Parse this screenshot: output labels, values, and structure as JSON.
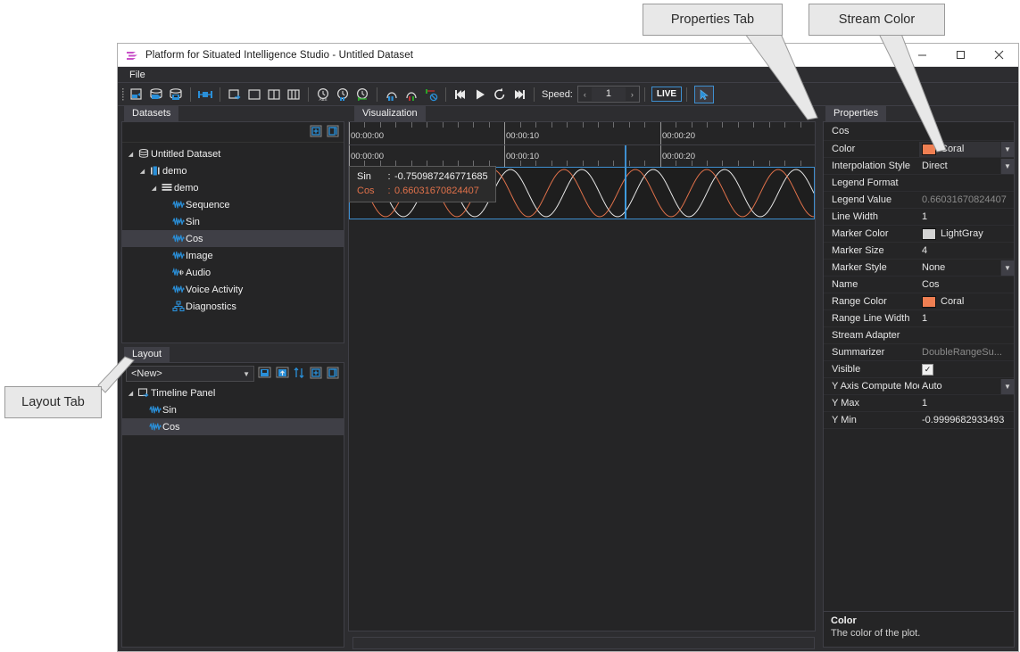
{
  "annotations": [
    {
      "id": "properties-tab",
      "label": "Properties Tab"
    },
    {
      "id": "stream-color",
      "label": "Stream Color"
    },
    {
      "id": "layout-tab",
      "label": "Layout Tab"
    }
  ],
  "window": {
    "title": "Platform for Situated Intelligence Studio - Untitled Dataset",
    "minimize_label": "—",
    "maximize_label": "☐",
    "close_label": "✕"
  },
  "menu": {
    "items": [
      {
        "label": "File"
      }
    ]
  },
  "toolbar": {
    "buttons": [
      {
        "name": "open-dataset-icon",
        "title": "Open Dataset"
      },
      {
        "name": "open-store-icon",
        "title": "Open Store"
      },
      {
        "name": "save-store-icon",
        "title": "Save Store"
      },
      {
        "name": "selection-icon",
        "title": "Selection"
      },
      {
        "name": "insert-timeline-panel-icon",
        "title": "Insert Timeline Panel"
      },
      {
        "name": "insert-1cell-panel-icon",
        "title": "Insert 1 Cell Panel"
      },
      {
        "name": "insert-2cell-panel-icon",
        "title": "Insert 2 Cell Panel"
      },
      {
        "name": "insert-3cell-panel-icon",
        "title": "Insert 3 Cell Panel"
      },
      {
        "name": "absolute-timing-icon",
        "title": "Absolute Timing"
      },
      {
        "name": "timing-relative-start-icon",
        "title": "Timing Relative To Start"
      },
      {
        "name": "timing-relative-selection-icon",
        "title": "Timing Relative To Selection"
      },
      {
        "name": "selection-start-icon",
        "title": "Selection Start"
      },
      {
        "name": "selection-end-icon",
        "title": "Selection End"
      },
      {
        "name": "clear-selection-icon",
        "title": "Clear Selection"
      },
      {
        "name": "move-to-start-icon",
        "title": "Move To Start"
      },
      {
        "name": "play-icon",
        "title": "Play"
      },
      {
        "name": "loop-icon",
        "title": "Loop"
      },
      {
        "name": "move-to-end-icon",
        "title": "Move To End"
      }
    ],
    "speed_label": "Speed:",
    "speed_value": "1",
    "speed_prev": "‹",
    "speed_next": "›",
    "live_label": "LIVE",
    "cursor_mode_icon": "cursor-arrow-icon"
  },
  "datasets": {
    "tab_label": "Datasets",
    "tools": [
      {
        "name": "add-dataset-button",
        "title": "Add Dataset"
      },
      {
        "name": "copy-dataset-button",
        "title": "Copy"
      }
    ],
    "tree": [
      {
        "label": "Untitled Dataset",
        "depth": 0,
        "icon": "database-icon",
        "expander": "◢",
        "selected": false
      },
      {
        "label": "demo",
        "depth": 1,
        "icon": "session-icon",
        "expander": "◢",
        "selected": false
      },
      {
        "label": "demo",
        "depth": 2,
        "icon": "partition-icon",
        "expander": "◢",
        "selected": false
      },
      {
        "label": "Sequence",
        "depth": 3,
        "icon": "stream-icon",
        "expander": "",
        "selected": false
      },
      {
        "label": "Sin",
        "depth": 3,
        "icon": "stream-icon",
        "expander": "",
        "selected": false
      },
      {
        "label": "Cos",
        "depth": 3,
        "icon": "stream-icon",
        "expander": "",
        "selected": true
      },
      {
        "label": "Image",
        "depth": 3,
        "icon": "stream-icon",
        "expander": "",
        "selected": false
      },
      {
        "label": "Audio",
        "depth": 3,
        "icon": "audio-stream-icon",
        "expander": "",
        "selected": false
      },
      {
        "label": "Voice Activity",
        "depth": 3,
        "icon": "stream-icon",
        "expander": "",
        "selected": false
      },
      {
        "label": "Diagnostics",
        "depth": 3,
        "icon": "diagnostics-icon",
        "expander": "",
        "selected": false
      }
    ]
  },
  "layout": {
    "tab_label": "Layout",
    "combo_value": "<New>",
    "combo_arrow": "▼",
    "tools": [
      {
        "name": "save-layout-button",
        "title": "Save Layout"
      },
      {
        "name": "load-layout-button",
        "title": "Load Layout"
      },
      {
        "name": "reorder-button",
        "title": "Reorder"
      },
      {
        "name": "add-panel-button",
        "title": "Add Panel"
      },
      {
        "name": "copy-panel-button",
        "title": "Copy Panel"
      }
    ],
    "tree": [
      {
        "label": "Timeline Panel",
        "depth": 0,
        "icon": "timeline-panel-icon",
        "expander": "◢",
        "selected": false
      },
      {
        "label": "Sin",
        "depth": 1,
        "icon": "stream-icon",
        "expander": "",
        "selected": false
      },
      {
        "label": "Cos",
        "depth": 1,
        "icon": "stream-icon",
        "expander": "",
        "selected": true
      }
    ]
  },
  "visualization": {
    "tab_label": "Visualization",
    "ruler_labels": [
      "00:00:00",
      "00:00:10",
      "00:00:20"
    ],
    "ruler2_labels": [
      "00:00:00",
      "00:00:10",
      "00:00:20"
    ],
    "cursor_position_pct": 59.2,
    "tooltip": {
      "rows": [
        {
          "name": "Sin",
          "colon": ":",
          "value": "-0.750987246771685",
          "color": "#e6e6e6"
        },
        {
          "name": "Cos",
          "colon": ":",
          "value": "0.66031670824407",
          "color": "#e0714a"
        }
      ]
    }
  },
  "chart_data": {
    "type": "line",
    "title": "Timeline Panel",
    "xlabel": "",
    "ylabel": "",
    "xlim": [
      0,
      26
    ],
    "ylim": [
      -1,
      1
    ],
    "grid": false,
    "legend": "tooltip",
    "series": [
      {
        "name": "Sin",
        "color": "#e6e6e6",
        "line_width": 1,
        "formula": "sin(2*pi*t/4.0)",
        "period_seconds": 4.0,
        "amplitude": 1.0,
        "phase": 0.0
      },
      {
        "name": "Cos",
        "color": "#e0714a",
        "line_width": 1,
        "formula": "cos(2*pi*t/4.0)",
        "period_seconds": 4.0,
        "amplitude": 1.0,
        "phase": 1.5707963
      }
    ],
    "cursor_time": "00:00:15.4",
    "values_at_cursor": {
      "Sin": -0.750987246771685,
      "Cos": 0.66031670824407
    }
  },
  "properties": {
    "tab_label": "Properties",
    "object_name": "Cos",
    "rows": [
      {
        "name": "Color",
        "value": "Coral",
        "type": "color",
        "color": "#ef7f52",
        "dropdown": true,
        "selected": true
      },
      {
        "name": "Interpolation Style",
        "value": "Direct",
        "type": "enum",
        "dropdown": true
      },
      {
        "name": "Legend Format",
        "value": "",
        "type": "text"
      },
      {
        "name": "Legend Value",
        "value": "0.66031670824407",
        "type": "readonly"
      },
      {
        "name": "Line Width",
        "value": "1",
        "type": "text"
      },
      {
        "name": "Marker Color",
        "value": "LightGray",
        "type": "color",
        "color": "#d3d3d3"
      },
      {
        "name": "Marker Size",
        "value": "4",
        "type": "text"
      },
      {
        "name": "Marker Style",
        "value": "None",
        "type": "enum",
        "dropdown": true
      },
      {
        "name": "Name",
        "value": "Cos",
        "type": "text"
      },
      {
        "name": "Range Color",
        "value": "Coral",
        "type": "color",
        "color": "#ef7f52"
      },
      {
        "name": "Range Line Width",
        "value": "1",
        "type": "text"
      },
      {
        "name": "Stream Adapter",
        "value": "",
        "type": "text"
      },
      {
        "name": "Summarizer",
        "value": "DoubleRangeSu...",
        "type": "readonly"
      },
      {
        "name": "Visible",
        "value": "✓",
        "type": "checkbox"
      },
      {
        "name": "Y Axis Compute Mode",
        "value": "Auto",
        "type": "enum",
        "dropdown": true
      },
      {
        "name": "Y Max",
        "value": "1",
        "type": "text"
      },
      {
        "name": "Y Min",
        "value": "-0.9999682933493",
        "type": "text"
      }
    ],
    "help_title": "Color",
    "help_text": "The color of the plot."
  },
  "colors": {
    "accent": "#3e8fd0",
    "sin_stream": "#e6e6e6",
    "cos_stream": "#e0714a",
    "coral": "#ef7f52",
    "lightgray": "#d3d3d3",
    "panel_bg": "#252526",
    "chrome_bg": "#2d2d30"
  }
}
